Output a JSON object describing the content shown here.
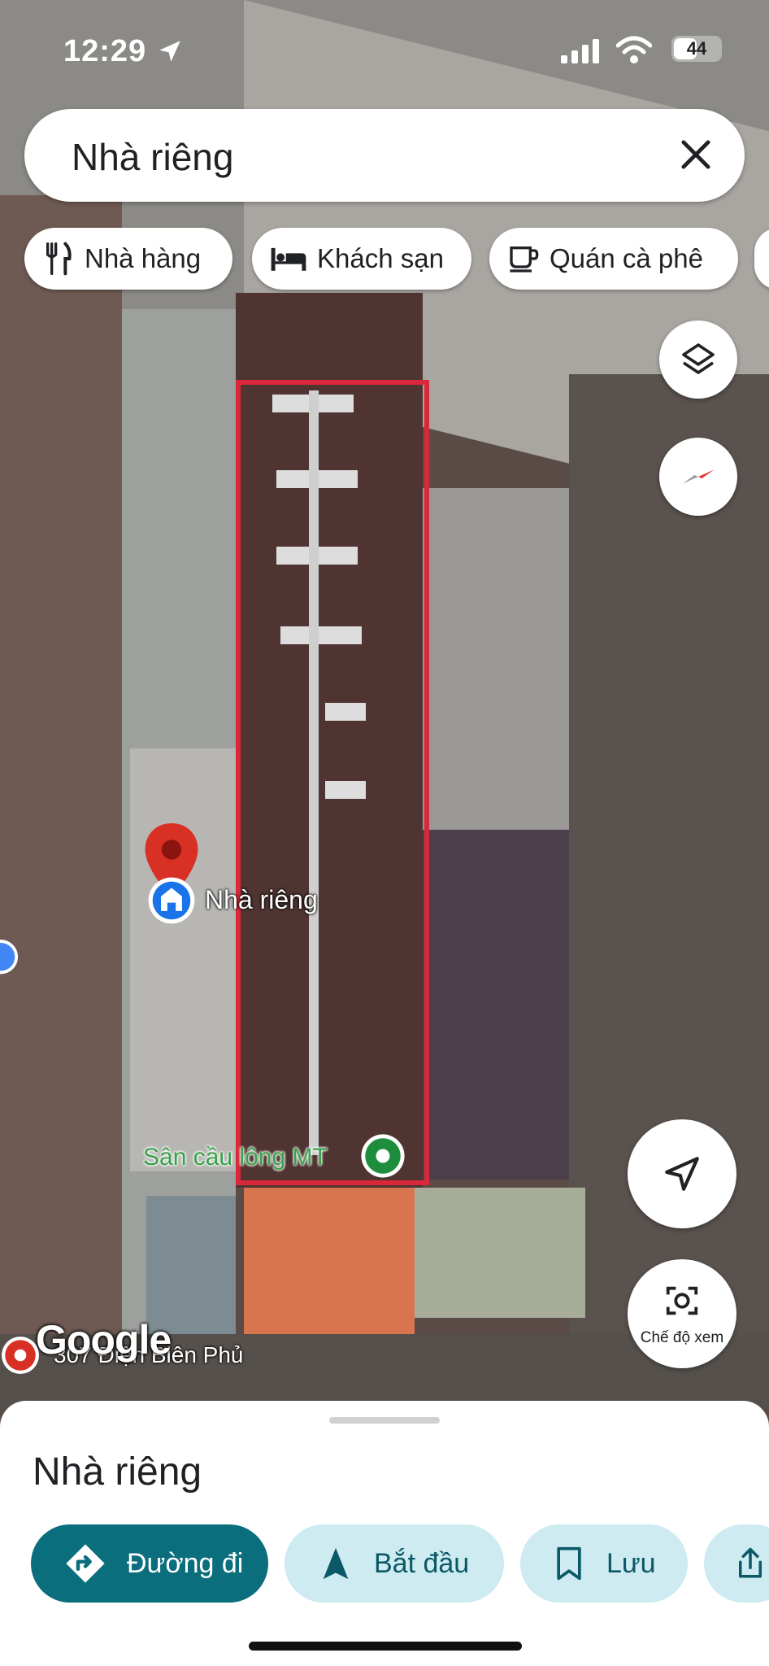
{
  "status": {
    "time": "12:29",
    "battery": "44"
  },
  "search": {
    "query": "Nhà riêng"
  },
  "chips": [
    {
      "label": "Nhà hàng",
      "icon": "restaurant-icon"
    },
    {
      "label": "Khách sạn",
      "icon": "hotel-icon"
    },
    {
      "label": "Quán cà phê",
      "icon": "coffee-icon"
    }
  ],
  "map": {
    "pin_label": "Nhà riêng",
    "poi_label": "Sân cầu lông MT",
    "address_label": "307 Điện Biên Phủ",
    "logo": "Google",
    "view_mode_label": "Chế độ xem",
    "highlight_color": "#d8283a"
  },
  "sheet": {
    "title": "Nhà riêng",
    "actions": [
      {
        "label": "Đường đi",
        "icon": "directions-icon"
      },
      {
        "label": "Bắt đầu",
        "icon": "navigation-arrow-icon"
      },
      {
        "label": "Lưu",
        "icon": "bookmark-icon"
      }
    ]
  },
  "colors": {
    "primary": "#0b6e7d",
    "secondary": "#cdebf1",
    "pin": "#d93025"
  }
}
